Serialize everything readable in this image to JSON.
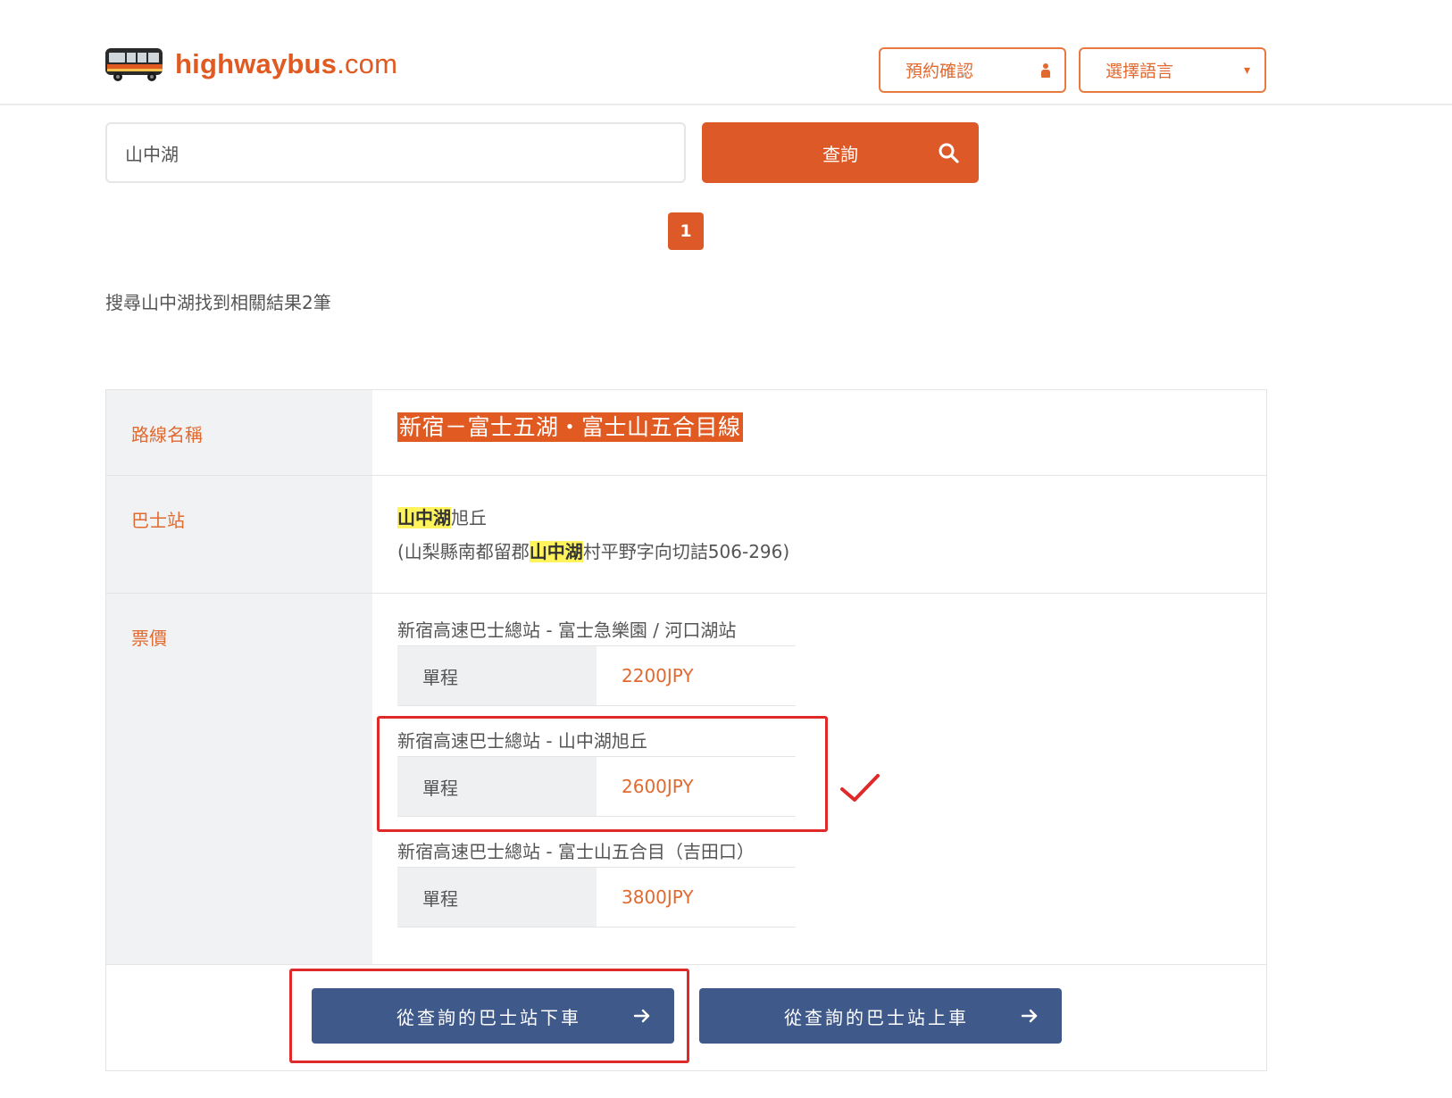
{
  "header": {
    "logo_brand": "highwaybus",
    "logo_suffix": ".com",
    "confirm_label": "預約確認",
    "language_label": "選擇語言",
    "accent_color": "#dd5a28"
  },
  "search": {
    "value": "山中湖",
    "button_label": "查詢"
  },
  "pagination": {
    "current_page": "1"
  },
  "results": {
    "summary": "搜尋山中湖找到相關結果2筆"
  },
  "route": {
    "label_route_name": "路線名稱",
    "route_name": "新宿－富士五湖・富士山五合目線",
    "label_bus_stop": "巴士站",
    "stop_name_highlight": "山中湖",
    "stop_name_rest": "旭丘",
    "stop_addr_prefix": "(山梨縣南都留郡",
    "stop_addr_highlight": "山中湖",
    "stop_addr_suffix": "村平野字向切詰506-296)",
    "label_fare": "票價",
    "fares": [
      {
        "title": "新宿高速巴士總站 - 富士急樂園 / 河口湖站",
        "type": "單程",
        "price": "2200JPY"
      },
      {
        "title": "新宿高速巴士總站 - 山中湖旭丘",
        "type": "單程",
        "price": "2600JPY"
      },
      {
        "title": "新宿高速巴士總站 - 富士山五合目（吉田口）",
        "type": "單程",
        "price": "3800JPY"
      }
    ]
  },
  "actions": {
    "alight_label": "從查詢的巴士站下車",
    "board_label": "從查詢的巴士站上車"
  },
  "annotation_colors": {
    "highlight_box": "#e02a2a",
    "checkmark": "#e02a2a"
  }
}
